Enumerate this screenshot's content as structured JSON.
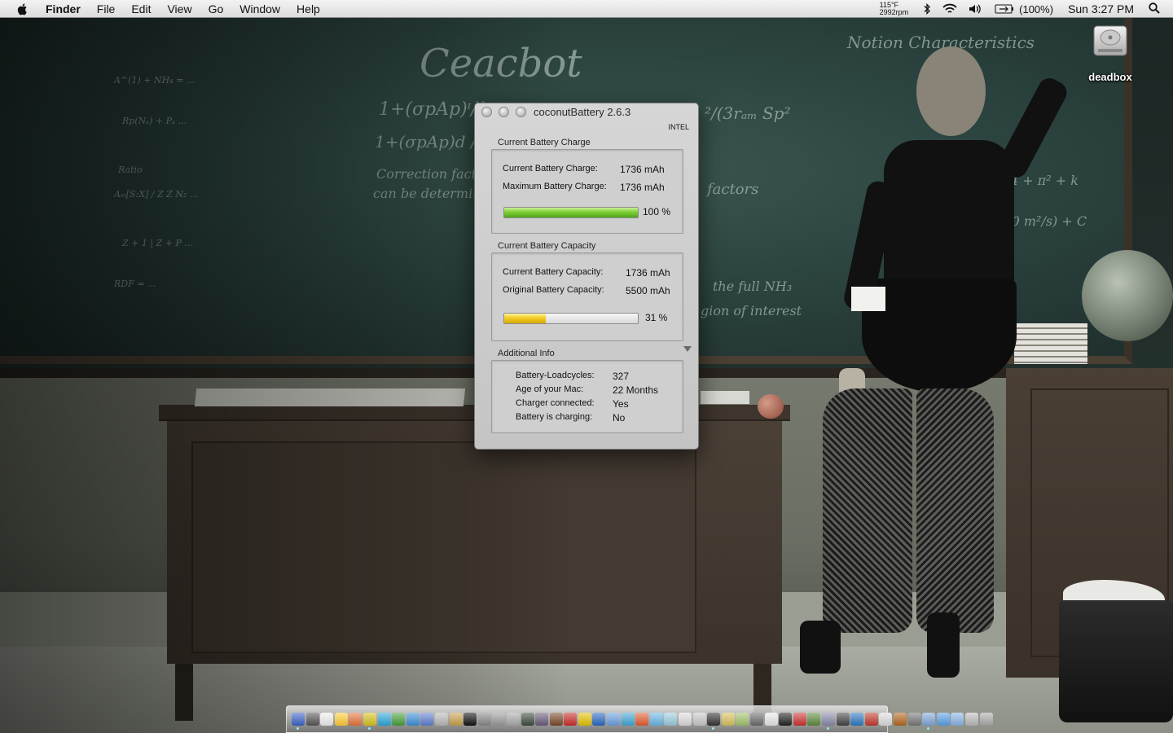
{
  "menubar": {
    "app_name": "Finder",
    "items": [
      "File",
      "Edit",
      "View",
      "Go",
      "Window",
      "Help"
    ],
    "temperature": "115°F",
    "fan_speed": "2992rpm",
    "battery_percent": "(100%)",
    "clock": "Sun 3:27 PM",
    "icons": [
      "apple-icon",
      "bluetooth-icon",
      "wifi-icon",
      "volume-icon",
      "battery-icon",
      "spotlight-icon"
    ]
  },
  "desktop": {
    "disk_label": "deadbox"
  },
  "window": {
    "title": "coconutBattery 2.6.3",
    "platform": "INTEL",
    "charge_section": {
      "title": "Current Battery Charge",
      "current_label": "Current Battery Charge:",
      "current_value": "1736 mAh",
      "max_label": "Maximum Battery Charge:",
      "max_value": "1736 mAh",
      "percent": 100,
      "percent_text": "100 %"
    },
    "capacity_section": {
      "title": "Current Battery Capacity",
      "current_label": "Current Battery Capacity:",
      "current_value": "1736 mAh",
      "original_label": "Original Battery Capacity:",
      "original_value": "5500 mAh",
      "percent": 31,
      "percent_text": "31 %"
    },
    "info_section": {
      "title": "Additional Info",
      "rows": [
        {
          "label": "Battery-Loadcycles:",
          "value": "327"
        },
        {
          "label": "Age of your Mac:",
          "value": "22 Months"
        },
        {
          "label": "Charger connected:",
          "value": "Yes"
        },
        {
          "label": "Battery is charging:",
          "value": "No"
        }
      ]
    },
    "accent_green": "#7fcf34",
    "accent_yellow": "#f2cc24"
  },
  "dock": {
    "colors": [
      "#3a63c8",
      "#555",
      "#eee",
      "#ffcc33",
      "#e8743a",
      "#d9c21d",
      "#2aa7d8",
      "#46a03d",
      "#3b8fd8",
      "#5f7fd0",
      "#b8b8b8",
      "#caa04a",
      "#111",
      "#888",
      "#999",
      "#aaa",
      "#3c4c3c",
      "#6a5a7a",
      "#7a4a2a",
      "#cc2b2b",
      "#e6c200",
      "#2a6ac0",
      "#6aa0e0",
      "#3fa7d6",
      "#e25d2f",
      "#69b7e8",
      "#9cd",
      "#ddd",
      "#c8c8c8",
      "#333",
      "#d6c15a",
      "#a4c26c",
      "#6b6b6b",
      "#e8e8e8",
      "#222",
      "#c33",
      "#5d8a3c",
      "#88a",
      "#444",
      "#2b79c2",
      "#c0392b",
      "#ddd",
      "#b5651d",
      "#777",
      "#7fa6d9",
      "#5aa0e6",
      "#8ab4e8",
      "#bbb",
      "#aaa"
    ],
    "running": [
      0,
      5,
      29,
      37,
      44
    ]
  }
}
